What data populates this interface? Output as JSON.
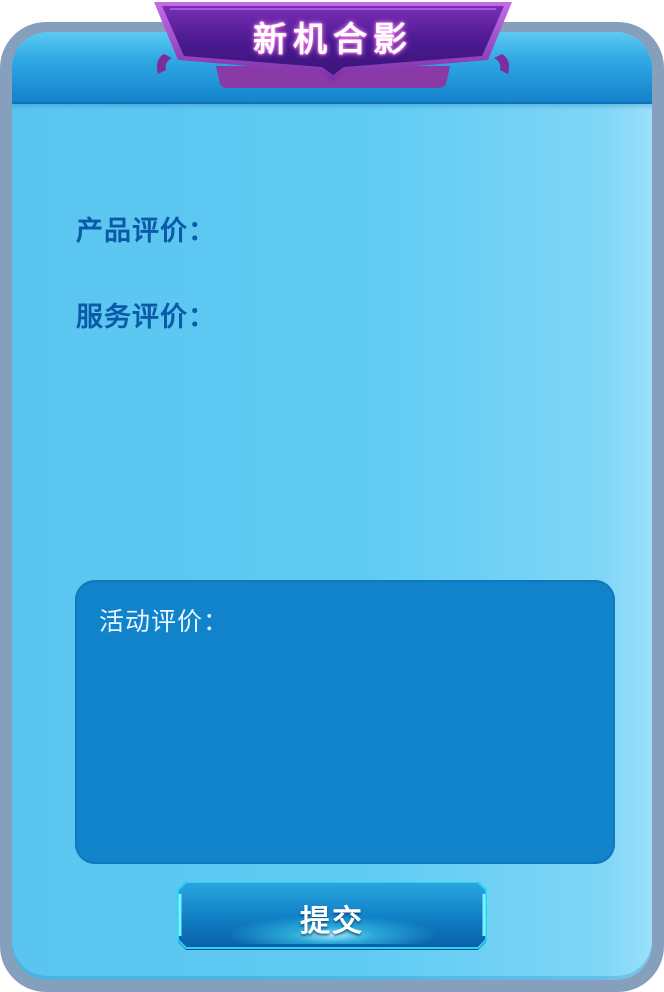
{
  "dialog": {
    "title": "新机合影"
  },
  "fields": {
    "product_label": "产品评价：",
    "service_label": "服务评价：",
    "activity_label": "活动评价："
  },
  "actions": {
    "submit_label": "提交"
  },
  "colors": {
    "frame": "#869fbd",
    "panel": "#5fcbf3",
    "header": "#1483cc",
    "banner": "#4a1a8c",
    "label": "#0b5aa8",
    "comment_box": "#1183ca",
    "button": "#0f7fc4"
  }
}
